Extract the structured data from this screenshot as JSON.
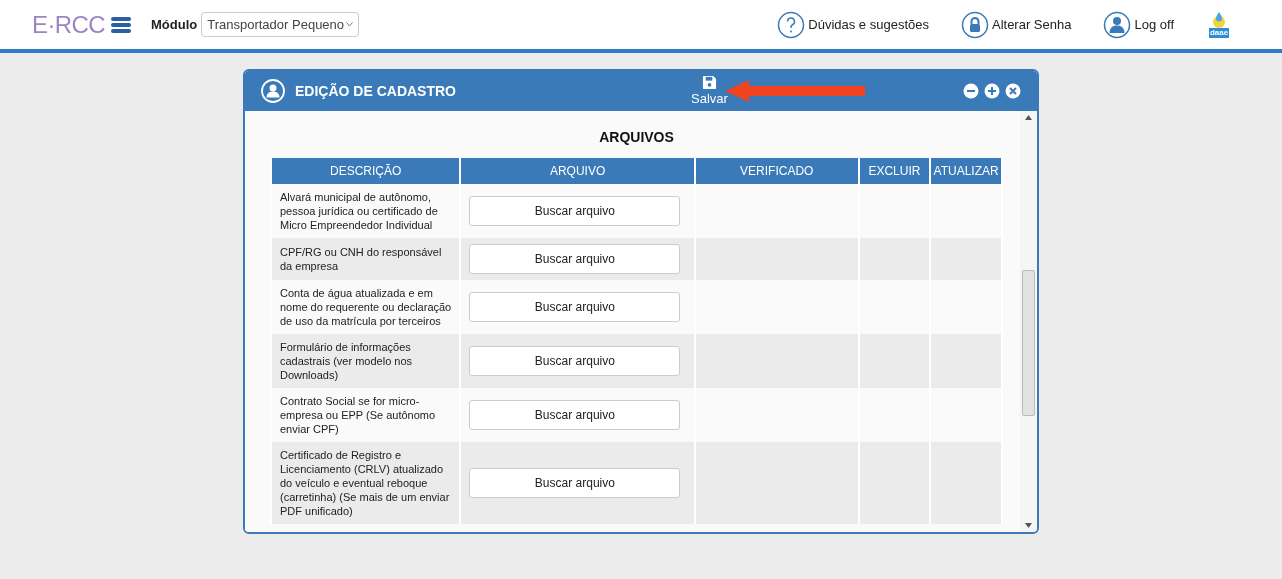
{
  "header": {
    "logo": "E·RCC",
    "module_label": "Módulo",
    "module_value": "Transportador Pequeno",
    "links": [
      {
        "kind": "help",
        "label": "Dúvidas e sugestões"
      },
      {
        "kind": "password",
        "label": "Alterar Senha"
      },
      {
        "kind": "user",
        "label": "Log off"
      }
    ],
    "brand": "daae"
  },
  "dialog": {
    "title": "EDIÇÃO DE CADASTRO",
    "save_label": "Salvar",
    "section_title": "ARQUIVOS",
    "columns": [
      "DESCRIÇÃO",
      "ARQUIVO",
      "VERIFICADO",
      "EXCLUIR",
      "ATUALIZAR"
    ],
    "rows": [
      {
        "description": "Alvará municipal de autônomo, pessoa jurídica ou certificado de Micro Empreendedor Individual",
        "button": "Buscar arquivo"
      },
      {
        "description": "CPF/RG ou CNH do responsável da empresa",
        "button": "Buscar arquivo"
      },
      {
        "description": "Conta de água atualizada e em nome do requerente ou declaração de uso da matrícula por terceiros",
        "button": "Buscar arquivo"
      },
      {
        "description": "Formulário de informações cadastrais (ver modelo nos Downloads)",
        "button": "Buscar arquivo"
      },
      {
        "description": "Contrato Social se for micro-empresa ou EPP (Se autônomo enviar CPF)",
        "button": "Buscar arquivo"
      },
      {
        "description": "Certificado de Registro e Licenciamento (CRLV) atualizado do veículo e eventual reboque (carretinha) (Se mais de um enviar PDF unificado)",
        "button": "Buscar arquivo"
      }
    ]
  }
}
